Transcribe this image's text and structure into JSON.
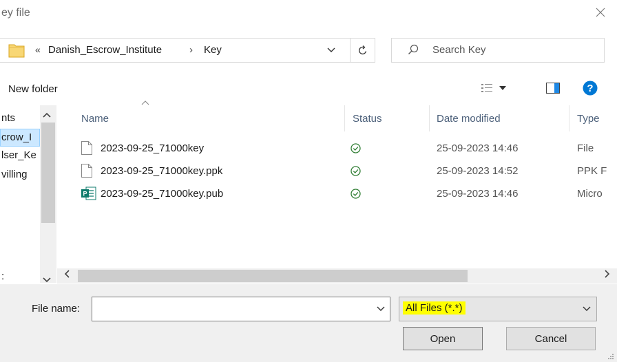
{
  "window": {
    "title": "ey file"
  },
  "address": {
    "overflow_chevron": "«",
    "breadcrumbs": [
      "Danish_Escrow_Institute",
      "Key"
    ],
    "separator": "›"
  },
  "search": {
    "placeholder": "Search Key"
  },
  "toolbar": {
    "new_folder_label": "New folder"
  },
  "nav": {
    "items": [
      "nts",
      "crow_I",
      "lser_Ke",
      "villing",
      ":"
    ],
    "selected_index": 1
  },
  "columns": {
    "name": "Name",
    "status": "Status",
    "date": "Date modified",
    "type": "Type"
  },
  "files": [
    {
      "name": "2023-09-25_71000key",
      "date": "25-09-2023 14:46",
      "type": "File",
      "icon": "document-icon"
    },
    {
      "name": "2023-09-25_71000key.ppk",
      "date": "25-09-2023 14:52",
      "type": "PPK F",
      "icon": "document-icon"
    },
    {
      "name": "2023-09-25_71000key.pub",
      "date": "25-09-2023 14:46",
      "type": "Micro",
      "icon": "publisher-file-icon"
    }
  ],
  "bottom": {
    "file_name_label": "File name:",
    "file_name_value": "",
    "file_type": "All Files (*.*)",
    "open_label": "Open",
    "cancel_label": "Cancel"
  },
  "colors": {
    "accent": "#0078d4",
    "status_green": "#2e7d32",
    "highlight": "#ffff00",
    "folder": "#f8d775"
  }
}
